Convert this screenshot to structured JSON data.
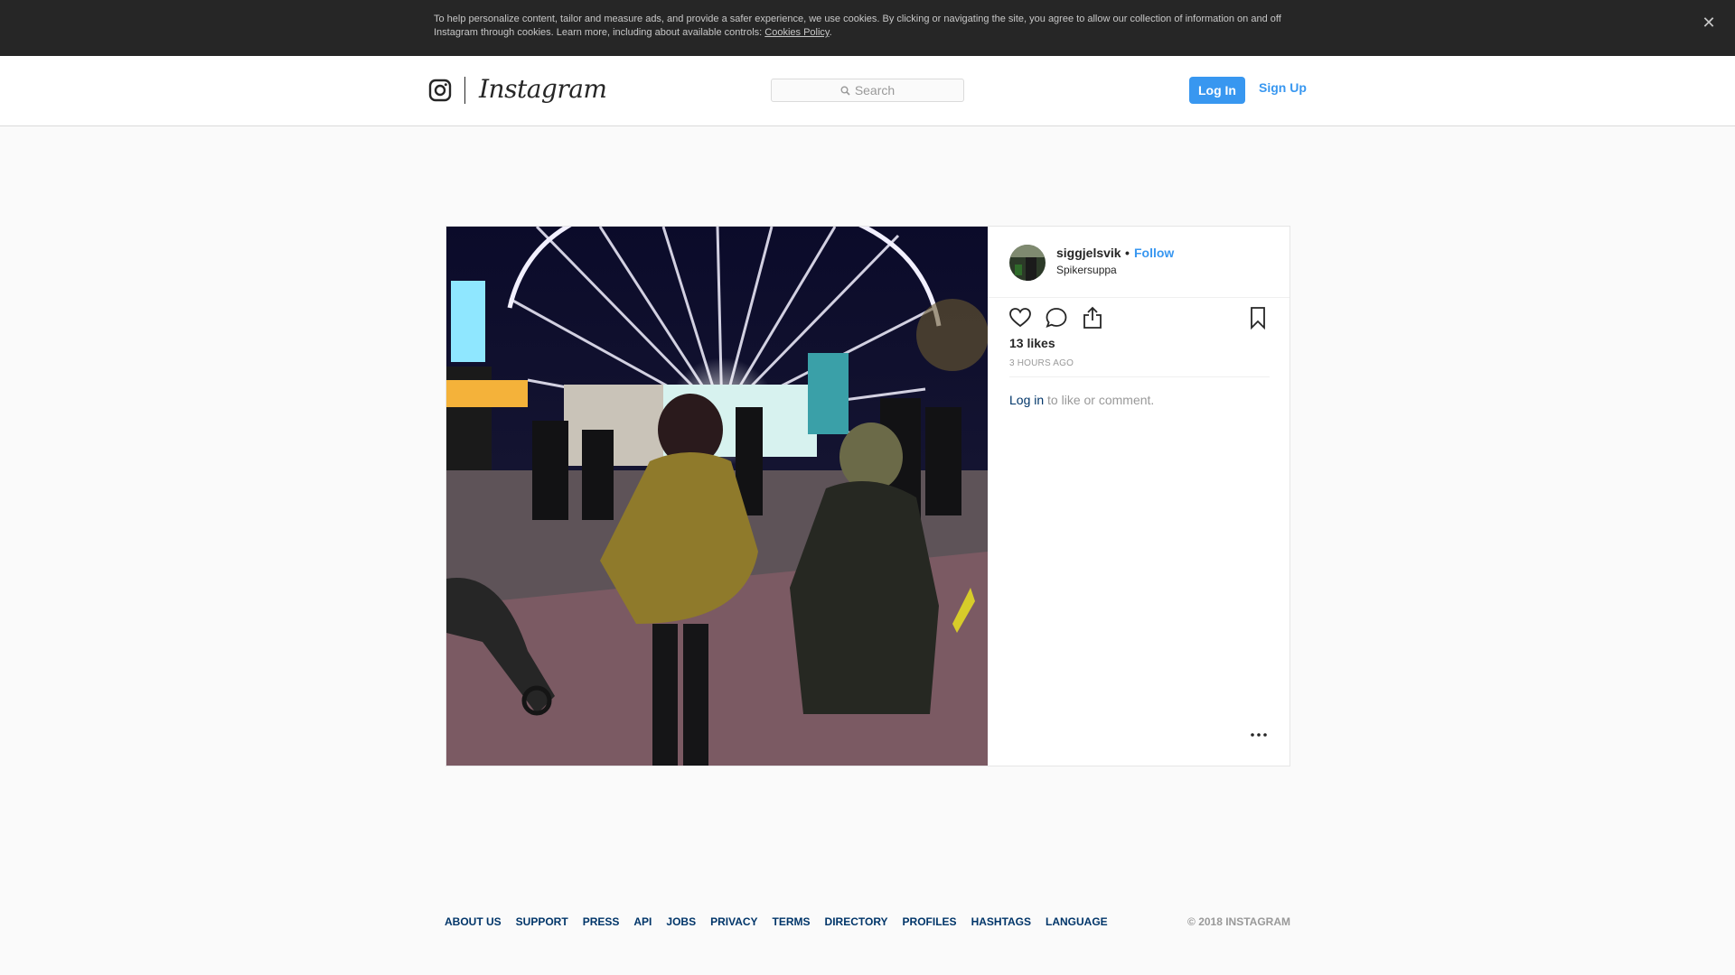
{
  "cookie_banner": {
    "text": "To help personalize content, tailor and measure ads, and provide a safer experience, we use cookies. By clicking or navigating the site, you agree to allow our collection of information on and off Instagram through cookies. Learn more, including about available controls: ",
    "link_label": "Cookies Policy",
    "suffix": ".",
    "close_glyph": "✕"
  },
  "nav": {
    "brand": "Instagram",
    "search_placeholder": "Search",
    "login_label": "Log In",
    "signup_label": "Sign Up"
  },
  "post": {
    "username": "siggjelsvik",
    "separator": "•",
    "follow_label": "Follow",
    "location": "Spikersuppa",
    "likes": "13 likes",
    "time": "3 HOURS AGO",
    "login_link": "Log in",
    "login_suffix": " to like or comment.",
    "icons": [
      "heart-icon",
      "comment-icon",
      "share-icon",
      "bookmark-icon",
      "more-options-icon"
    ]
  },
  "footer": {
    "links": [
      "ABOUT US",
      "SUPPORT",
      "PRESS",
      "API",
      "JOBS",
      "PRIVACY",
      "TERMS",
      "DIRECTORY",
      "PROFILES",
      "HASHTAGS",
      "LANGUAGE"
    ],
    "copyright": "© 2018 INSTAGRAM"
  },
  "colors": {
    "accent": "#3897f0",
    "link_dark": "#003569",
    "banner_bg": "#262626",
    "page_bg": "#fafafa"
  }
}
